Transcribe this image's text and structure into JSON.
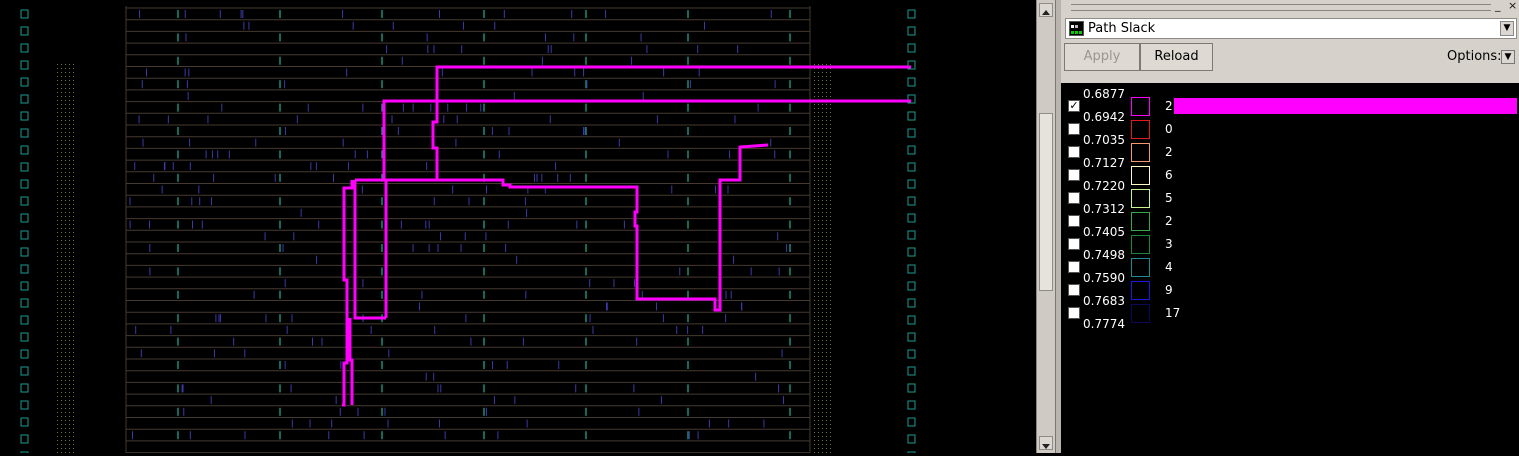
{
  "panel": {
    "window_controls": {
      "minimize": "_",
      "close": "×"
    },
    "metric_select": {
      "value": "Path Slack"
    },
    "apply_label": "Apply",
    "reload_label": "Reload",
    "options_label": "Options:"
  },
  "legend": {
    "edge_values": [
      "0.6877",
      "0.6942",
      "0.7035",
      "0.7127",
      "0.7220",
      "0.7312",
      "0.7405",
      "0.7498",
      "0.7590",
      "0.7683",
      "0.7774"
    ],
    "bins": [
      {
        "count": "2",
        "checked": true,
        "color": "#ff00ff",
        "bar_fraction": 1.0
      },
      {
        "count": "0",
        "checked": false,
        "color": "#e0191c",
        "bar_fraction": 0
      },
      {
        "count": "2",
        "checked": false,
        "color": "#f39a68",
        "bar_fraction": 0
      },
      {
        "count": "6",
        "checked": false,
        "color": "#fff8c8",
        "bar_fraction": 0
      },
      {
        "count": "5",
        "checked": false,
        "color": "#c6f58a",
        "bar_fraction": 0
      },
      {
        "count": "2",
        "checked": false,
        "color": "#36a84a",
        "bar_fraction": 0
      },
      {
        "count": "3",
        "checked": false,
        "color": "#168a3a",
        "bar_fraction": 0
      },
      {
        "count": "4",
        "checked": false,
        "color": "#1e8a94",
        "bar_fraction": 0
      },
      {
        "count": "9",
        "checked": false,
        "color": "#1a1ad8",
        "bar_fraction": 0
      },
      {
        "count": "17",
        "checked": false,
        "color": "#0a0a5a",
        "bar_fraction": 0
      }
    ]
  },
  "colors": {
    "highlight_path": "#ff00ff",
    "row_lines": "#463a30",
    "tap_cells": "#1b8b7a",
    "io_pins": "#1c9a90",
    "filler_dots": "#6e7a3a",
    "cell_marks": "#3d3aa6"
  }
}
